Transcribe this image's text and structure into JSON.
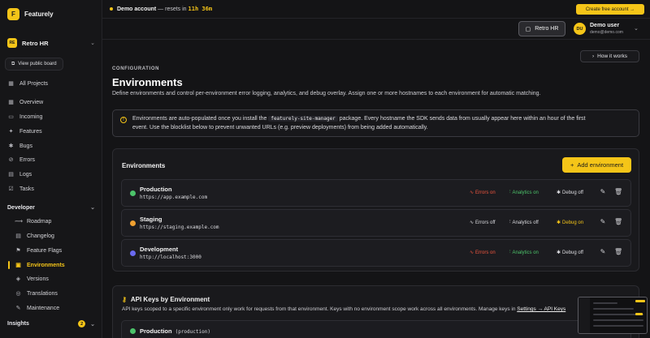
{
  "brand": {
    "logo_letter": "F",
    "name": "Featurely"
  },
  "project": {
    "logo": "RE",
    "name": "Retro HR"
  },
  "sidebar": {
    "public_board": "View public board",
    "all_projects": "All Projects",
    "main_items": [
      {
        "label": "Overview",
        "icon": "grid-icon"
      },
      {
        "label": "Incoming",
        "icon": "inbox-icon"
      },
      {
        "label": "Features",
        "icon": "sparkle-icon"
      },
      {
        "label": "Bugs",
        "icon": "bug-icon"
      },
      {
        "label": "Errors",
        "icon": "alert-icon"
      },
      {
        "label": "Logs",
        "icon": "file-icon"
      },
      {
        "label": "Tasks",
        "icon": "check-square-icon"
      }
    ],
    "developer_label": "Developer",
    "developer_items": [
      {
        "label": "Roadmap"
      },
      {
        "label": "Changelog"
      },
      {
        "label": "Feature Flags"
      },
      {
        "label": "Environments"
      },
      {
        "label": "Versions"
      },
      {
        "label": "Translations"
      },
      {
        "label": "Maintenance"
      }
    ],
    "insights_label": "Insights",
    "insights_badge": "2"
  },
  "topbar": {
    "demo_label": "Demo account",
    "demo_suffix": " — resets in ",
    "timer": "11h 36m",
    "create_button": "Create free account →"
  },
  "header": {
    "project_pill": "Retro HR",
    "user_initials": "DU",
    "user_name": "Demo user",
    "user_email": "demo@demo.com"
  },
  "main": {
    "how_it_works": "How it works",
    "eyebrow": "CONFIGURATION",
    "title": "Environments",
    "description": "Define environments and control per-environment error logging, analytics, and debug overlay. Assign one or more hostnames to each environment for automatic matching.",
    "info": {
      "line1_pre": "Environments are auto-populated once you install the ",
      "line1_code": "featurely-site-manager",
      "line1_post": " package. Every hostname the SDK sends data from usually appear here within an hour of the first",
      "line2": "event. Use the blocklist below to prevent unwanted URLs (e.g. preview deployments) from being added automatically."
    },
    "env_card_title": "Environments",
    "add_env_button": "Add environment",
    "environments": [
      {
        "name": "Production",
        "host": "https://app.example.com",
        "dot_color": "#4cc36a",
        "errors": "Errors on",
        "analytics": "Analytics on",
        "debug": "Debug off"
      },
      {
        "name": "Staging",
        "host": "https://staging.example.com",
        "dot_color": "#f0a030",
        "errors": "Errors off",
        "analytics": "Analytics off",
        "debug": "Debug on"
      },
      {
        "name": "Development",
        "host": "http://localhost:3000",
        "dot_color": "#6a6af0",
        "errors": "Errors on",
        "analytics": "Analytics on",
        "debug": "Debug off"
      }
    ],
    "api_keys": {
      "title": "API Keys by Environment",
      "description": "API keys scoped to a specific environment only work for requests from that environment. Keys with no environment scope work across all environments. Manage keys in ",
      "link": "Settings → API Keys",
      "row_name": "Production",
      "row_slug": "(production)"
    }
  },
  "colors": {
    "accent": "#f5c518",
    "on": "#4cc36a",
    "error_on": "#f0553e",
    "background": "#141416"
  }
}
